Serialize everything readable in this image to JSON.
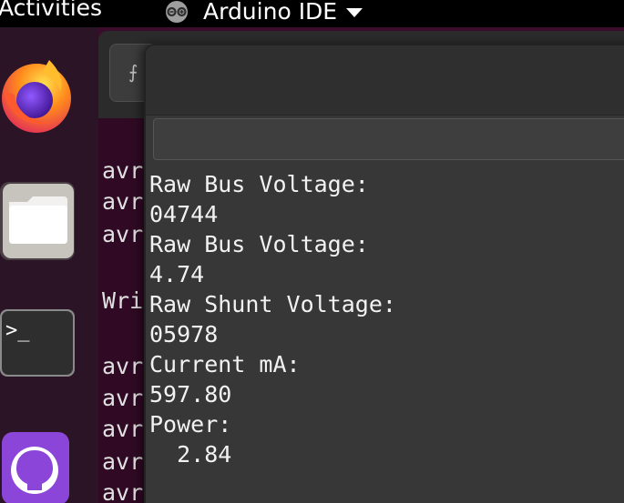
{
  "topbar": {
    "activities_label": "Activities",
    "app_name": "Arduino IDE"
  },
  "dock": {
    "items": [
      {
        "name": "Firefox",
        "icon": "firefox-icon"
      },
      {
        "name": "Files",
        "icon": "files-icon"
      },
      {
        "name": "Terminal",
        "icon": "terminal-icon",
        "glyph": ">_"
      },
      {
        "name": "GitHub Desktop",
        "icon": "github-icon"
      }
    ]
  },
  "background_terminal": {
    "visible_lines": [
      "avr",
      "avr",
      "avr",
      "",
      "Wri",
      "",
      "avr",
      "avr",
      "avr",
      "avr",
      "avr"
    ]
  },
  "serial_monitor": {
    "input_value": "",
    "output_lines": [
      "Raw Bus Voltage:",
      "04744",
      "Raw Bus Voltage:",
      "4.74",
      "Raw Shunt Voltage:",
      "05978",
      "Current mA:",
      "597.80",
      "Power:",
      "  2.84"
    ]
  },
  "colors": {
    "topbar": "#000000",
    "dock": "#2b1426",
    "terminal_bg": "#300a24",
    "serial_bg": "#373737",
    "text": "#f2f2f2"
  }
}
